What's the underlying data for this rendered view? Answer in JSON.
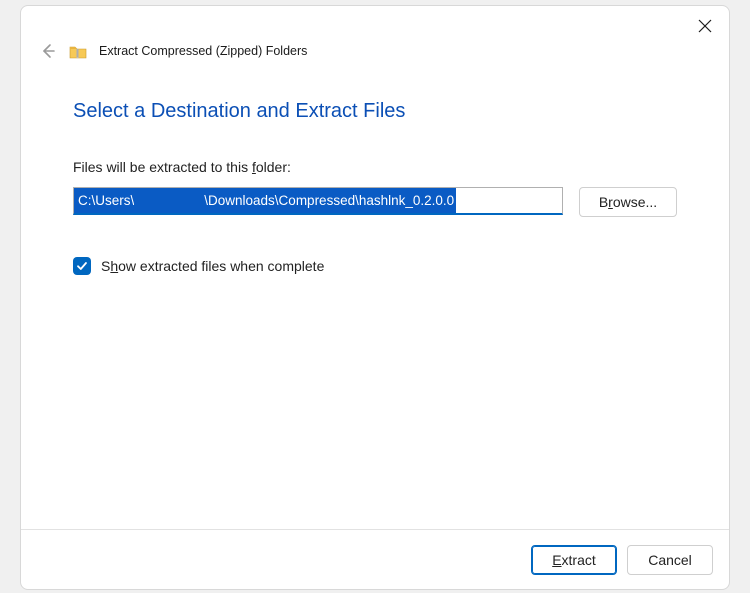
{
  "window": {
    "title": "Extract Compressed (Zipped) Folders"
  },
  "content": {
    "heading": "Select a Destination and Extract Files",
    "prompt_prefix": "Files will be extracted to this ",
    "prompt_hotkey": "f",
    "prompt_suffix": "older:",
    "path_prefix": "C:\\Users\\",
    "path_suffix": "\\Downloads\\Compressed\\hashlnk_0.2.0.0",
    "browse_pre": "B",
    "browse_hot": "r",
    "browse_post": "owse...",
    "checkbox_checked": true,
    "checkbox_pre": "S",
    "checkbox_hot": "h",
    "checkbox_post": "ow extracted files when complete"
  },
  "footer": {
    "extract_hot": "E",
    "extract_post": "xtract",
    "cancel": "Cancel"
  }
}
